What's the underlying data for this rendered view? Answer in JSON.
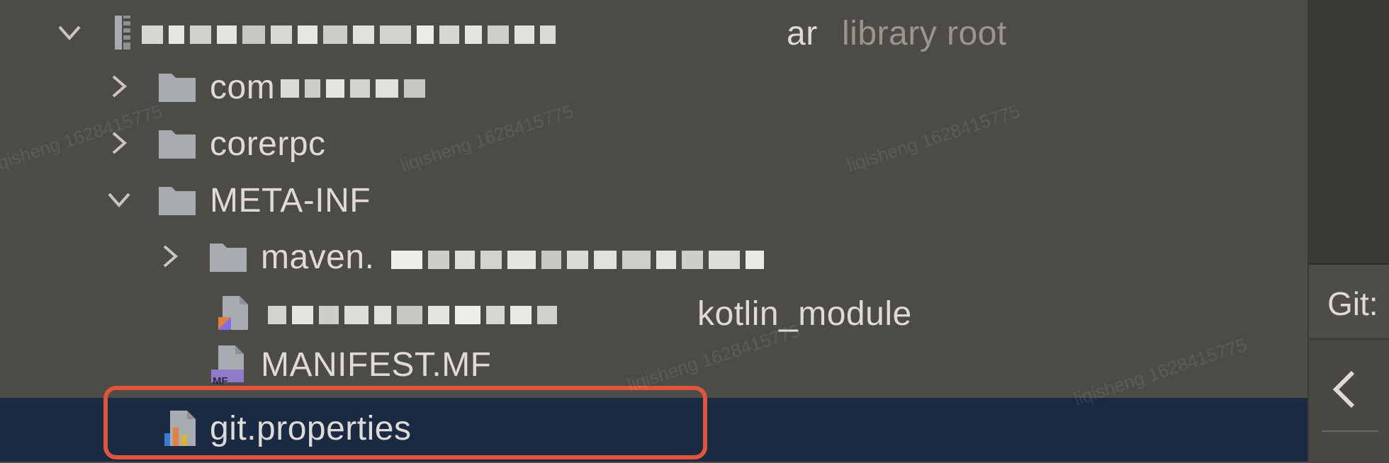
{
  "tree": {
    "root": {
      "name_visible_end": "ar",
      "suffix": "library root"
    },
    "items": [
      {
        "label": "com"
      },
      {
        "label": "corerpc"
      },
      {
        "label": "META-INF"
      },
      {
        "label": "maven."
      },
      {
        "label": "kotlin_module"
      },
      {
        "label": "MANIFEST.MF"
      },
      {
        "label": "git.properties"
      }
    ],
    "manifest_badge": "MF"
  },
  "right_panel": {
    "git_label": "Git:"
  },
  "watermark_text": "liqisheng 1628415775",
  "colors": {
    "background": "#4d4b45",
    "selection": "#1b2a43",
    "highlight_outline": "#e0553b",
    "folder_icon": "#a7acb1"
  }
}
